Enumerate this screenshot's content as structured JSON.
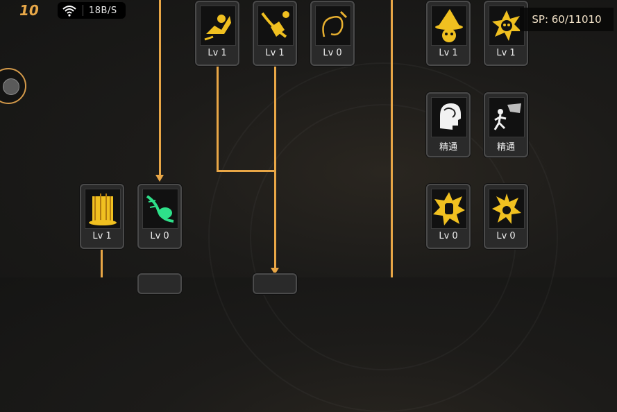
{
  "status": {
    "level": "10",
    "network_speed": "18B/S"
  },
  "sp": {
    "text": "SP: 60/11010"
  },
  "skills": [
    {
      "id": "s1",
      "level": "Lv 1",
      "icon": "summon-skill-icon"
    },
    {
      "id": "s2",
      "level": "Lv 1",
      "icon": "whip-strike-icon"
    },
    {
      "id": "s3",
      "level": "Lv 0",
      "icon": "whip-icon"
    },
    {
      "id": "s4",
      "level": "Lv 1",
      "icon": "witch-icon"
    },
    {
      "id": "s5",
      "level": "Lv 1",
      "icon": "skull-burst-icon"
    },
    {
      "id": "s6",
      "level": "精通",
      "icon": "mind-mastery-icon"
    },
    {
      "id": "s7",
      "level": "精通",
      "icon": "speed-mastery-icon"
    },
    {
      "id": "s8",
      "level": "Lv 1",
      "icon": "fire-pillar-icon"
    },
    {
      "id": "s9",
      "level": "Lv 0",
      "icon": "green-slash-icon"
    },
    {
      "id": "s10",
      "level": "Lv 0",
      "icon": "explosion-palm-icon"
    },
    {
      "id": "s11",
      "level": "Lv 0",
      "icon": "flame-burst-icon"
    }
  ],
  "colors": {
    "accent": "#e8a646",
    "icon_gold": "#f0c020",
    "icon_green": "#2ee08a"
  }
}
